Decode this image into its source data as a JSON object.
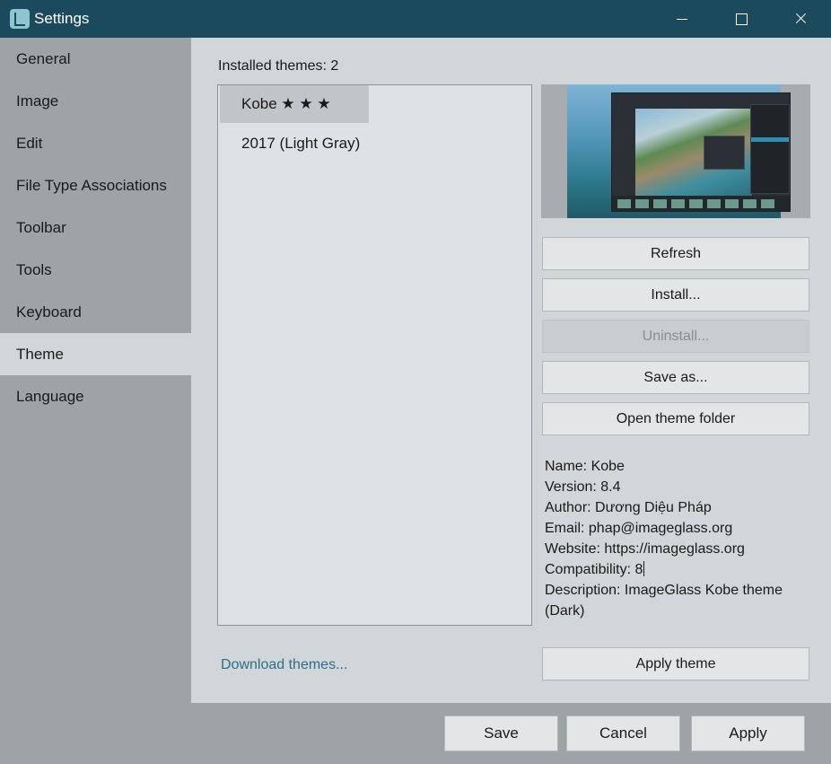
{
  "window": {
    "title": "Settings"
  },
  "sidebar": {
    "items": [
      {
        "label": "General"
      },
      {
        "label": "Image"
      },
      {
        "label": "Edit"
      },
      {
        "label": "File Type Associations"
      },
      {
        "label": "Toolbar"
      },
      {
        "label": "Tools"
      },
      {
        "label": "Keyboard"
      },
      {
        "label": "Theme",
        "active": true
      },
      {
        "label": "Language"
      }
    ]
  },
  "theme_panel": {
    "installed_label": "Installed themes: 2",
    "themes": [
      {
        "name": "Kobe  ★ ★ ★",
        "selected": true
      },
      {
        "name": "2017 (Light Gray)"
      }
    ],
    "buttons": {
      "refresh": "Refresh",
      "install": "Install...",
      "uninstall": "Uninstall...",
      "save_as": "Save as...",
      "open_folder": "Open theme folder",
      "apply_theme": "Apply theme"
    },
    "info": {
      "name": "Name: Kobe",
      "version": "Version: 8.4",
      "author": "Author: Dương Diệu Pháp",
      "email": "Email: phap@imageglass.org",
      "website": "Website: https://imageglass.org",
      "compatibility": "Compatibility: 8",
      "description": "Description: ImageGlass Kobe theme (Dark)"
    },
    "download_link": "Download themes..."
  },
  "footer": {
    "save": "Save",
    "cancel": "Cancel",
    "apply": "Apply"
  },
  "colors": {
    "titlebar": "#1b4a5c",
    "sidebar": "#9ea3a6",
    "panel": "#d1d6d8",
    "link": "#2d6f8b"
  }
}
